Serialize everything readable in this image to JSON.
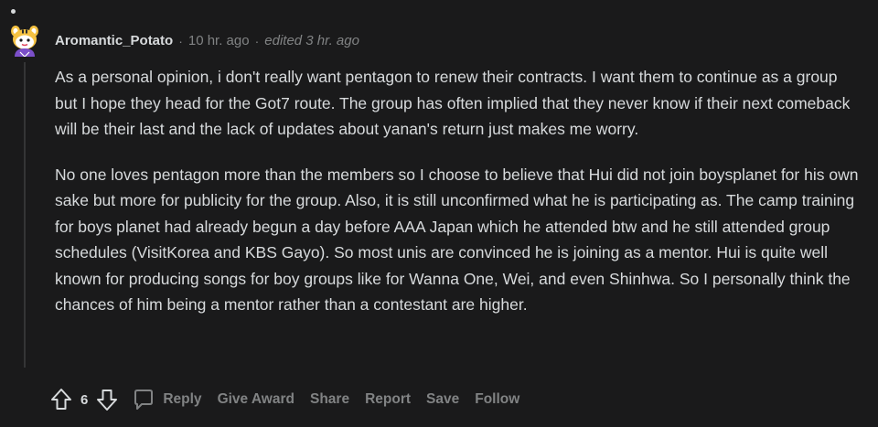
{
  "comment": {
    "author": "Aromantic_Potato",
    "separator": "·",
    "time": "10 hr. ago",
    "edited": "edited 3 hr. ago",
    "paragraphs": [
      "As a personal opinion, i don't really want pentagon to renew their contracts. I want them to continue as a group but I hope they head for the Got7 route. The group has often implied that they never know if their next comeback will be their last and the lack of updates about yanan's return just makes me worry.",
      "No one loves pentagon more than the members so I choose to believe that Hui did not join boysplanet for his own sake but more for publicity for the group. Also, it is still unconfirmed what he is participating as. The camp training for boys planet had already begun a day before AAA Japan which he attended btw and he still attended group schedules (VisitKorea and KBS Gayo). So most unis are convinced he is joining as a mentor. Hui is quite well known for producing songs for boy groups like for Wanna One, Wei, and even Shinhwa. So I personally think the chances of him being a mentor rather than a contestant are higher."
    ],
    "score": "6",
    "actions": {
      "reply": "Reply",
      "give_award": "Give Award",
      "share": "Share",
      "report": "Report",
      "save": "Save",
      "follow": "Follow"
    },
    "icons": {
      "avatar": "snoo-avatar-icon",
      "upvote": "arrow-up-icon",
      "downvote": "arrow-down-icon",
      "reply": "speech-bubble-icon"
    }
  },
  "colors": {
    "background": "#1a1a1b",
    "text": "#d7dadc",
    "meta": "#818384",
    "thread_line": "#343536"
  }
}
